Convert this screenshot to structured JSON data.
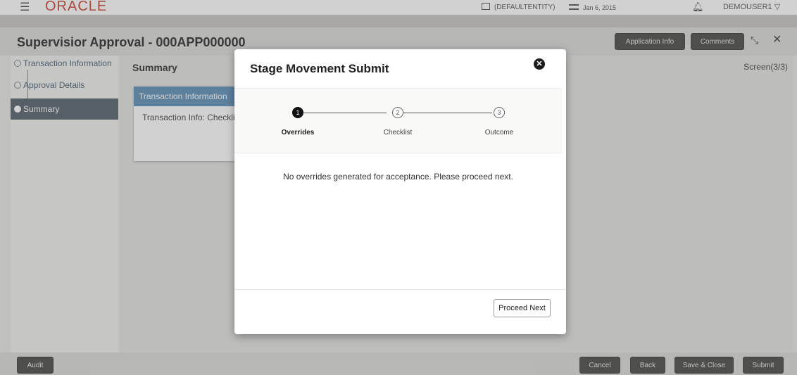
{
  "header": {
    "logo": "ORACLE",
    "entity": "(DEFAULTENTITY)",
    "date": "Jan 6, 2015",
    "user": "DEMOUSER1"
  },
  "titlebar": {
    "title": "Supervisior Approval - 000APP000000",
    "application_info": "Application Info",
    "comments": "Comments"
  },
  "sidebar": {
    "items": [
      {
        "label": "Transaction Information"
      },
      {
        "label": "Approval Details"
      },
      {
        "label": "Summary"
      }
    ]
  },
  "main": {
    "heading": "Summary",
    "screen": "Screen(3/3)",
    "card": {
      "title": "Transaction Information",
      "body": "Transaction Info: Checklist"
    }
  },
  "footer": {
    "audit": "Audit",
    "cancel": "Cancel",
    "back": "Back",
    "save_close": "Save & Close",
    "submit": "Submit"
  },
  "modal": {
    "title": "Stage Movement Submit",
    "steps": [
      {
        "number": "1",
        "label": "Overrides"
      },
      {
        "number": "2",
        "label": "Checklist"
      },
      {
        "number": "3",
        "label": "Outcome"
      }
    ],
    "message": "No overrides generated for acceptance. Please proceed next.",
    "proceed_label": "Proceed Next"
  },
  "colors": {
    "brand": "#c74634",
    "accent": "#5f8fb8",
    "nav_active": "#56616b"
  }
}
